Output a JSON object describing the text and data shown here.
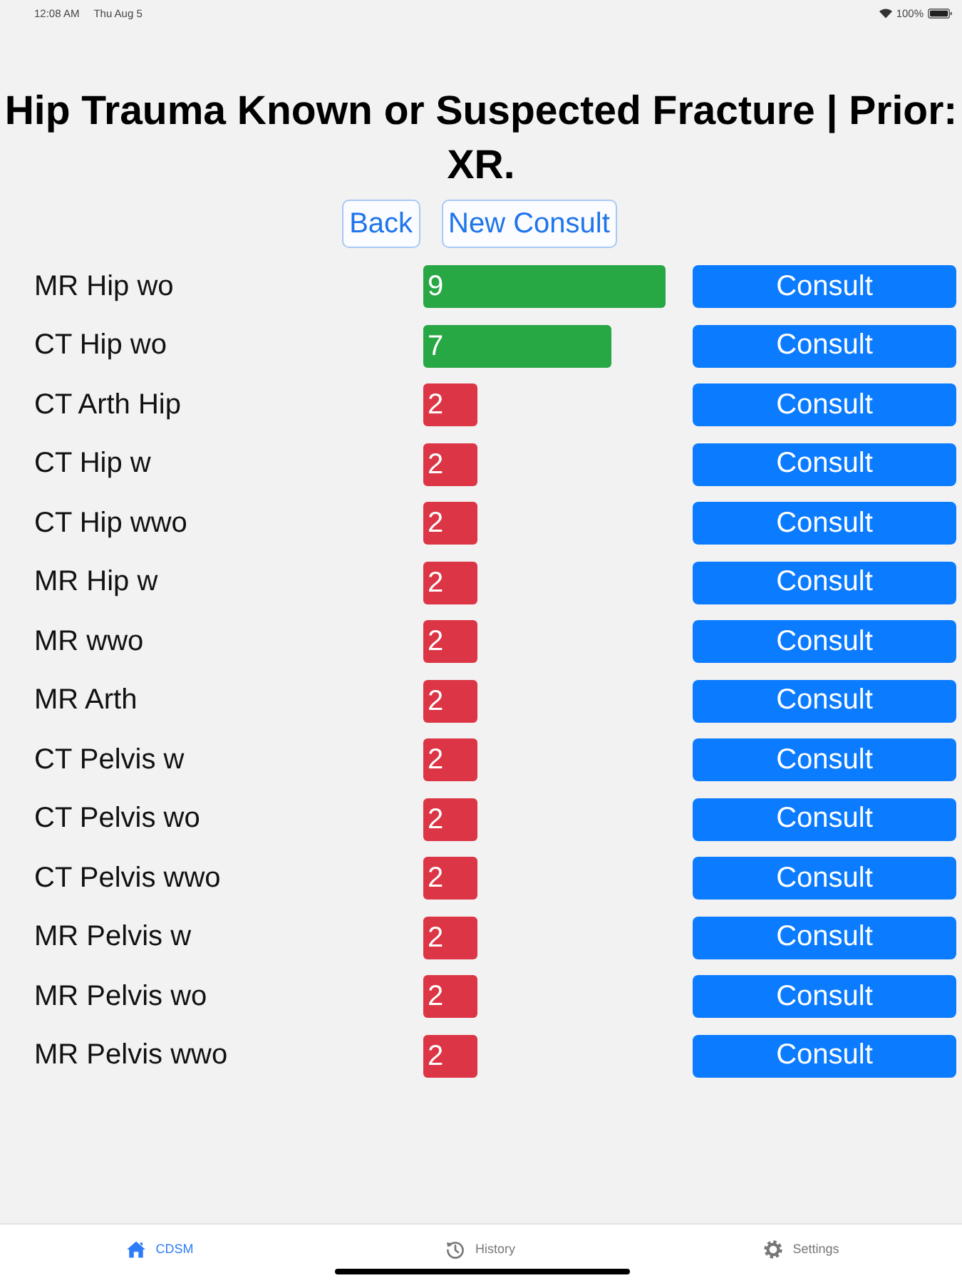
{
  "status_bar": {
    "time": "12:08 AM",
    "date": "Thu Aug 5",
    "battery": "100%"
  },
  "title": "Hip Trauma Known or Suspected Fracture | Prior: XR.",
  "actions": [
    "Back",
    "New Consult"
  ],
  "rows": [
    {
      "name": "MR Hip wo",
      "score": "9",
      "level": 1,
      "color": "#28a745",
      "action": "Consult"
    },
    {
      "name": "CT Hip wo",
      "score": "7",
      "level": 0.778,
      "color": "#28a745",
      "action": "Consult"
    },
    {
      "name": "CT Arth Hip",
      "score": "2",
      "level": 0.222,
      "color": "#dc3545",
      "action": "Consult"
    },
    {
      "name": "CT Hip w",
      "score": "2",
      "level": 0.222,
      "color": "#dc3545",
      "action": "Consult"
    },
    {
      "name": "CT Hip wwo",
      "score": "2",
      "level": 0.222,
      "color": "#dc3545",
      "action": "Consult"
    },
    {
      "name": "MR Hip w",
      "score": "2",
      "level": 0.222,
      "color": "#dc3545",
      "action": "Consult"
    },
    {
      "name": "MR wwo",
      "score": "2",
      "level": 0.222,
      "color": "#dc3545",
      "action": "Consult"
    },
    {
      "name": "MR Arth",
      "score": "2",
      "level": 0.222,
      "color": "#dc3545",
      "action": "Consult"
    },
    {
      "name": "CT Pelvis w",
      "score": "2",
      "level": 0.222,
      "color": "#dc3545",
      "action": "Consult"
    },
    {
      "name": "CT Pelvis wo",
      "score": "2",
      "level": 0.222,
      "color": "#dc3545",
      "action": "Consult"
    },
    {
      "name": "CT Pelvis wwo",
      "score": "2",
      "level": 0.222,
      "color": "#dc3545",
      "action": "Consult"
    },
    {
      "name": "MR Pelvis w",
      "score": "2",
      "level": 0.222,
      "color": "#dc3545",
      "action": "Consult"
    },
    {
      "name": "MR Pelvis wo",
      "score": "2",
      "level": 0.222,
      "color": "#dc3545",
      "action": "Consult"
    },
    {
      "name": "MR Pelvis wwo",
      "score": "2",
      "level": 0.222,
      "color": "#dc3545",
      "action": "Consult"
    }
  ],
  "tab_bar": [
    {
      "label": "CDSM",
      "selected": true
    },
    {
      "label": "History",
      "selected": false
    },
    {
      "label": "Settings",
      "selected": false
    }
  ]
}
